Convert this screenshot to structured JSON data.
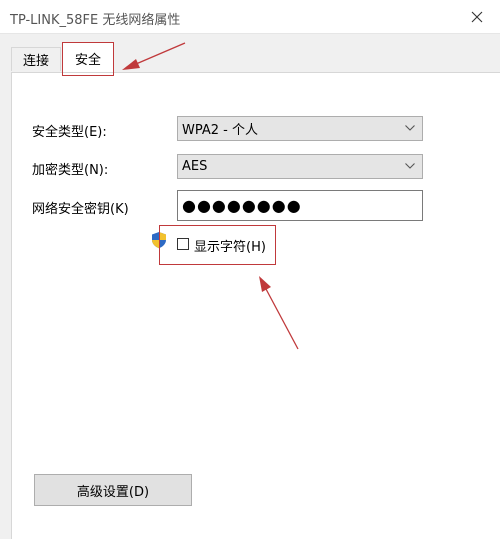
{
  "window": {
    "title": "TP-LINK_58FE 无线网络属性",
    "close_icon": "close-icon"
  },
  "tabs": [
    {
      "label": "连接",
      "selected": false
    },
    {
      "label": "安全",
      "selected": true
    }
  ],
  "form": {
    "security_type_label": "安全类型(E):",
    "security_type_value": "WPA2 - 个人",
    "encryption_type_label": "加密类型(N):",
    "encryption_type_value": "AES",
    "key_label": "网络安全密钥(K)",
    "key_value": "●●●●●●●●",
    "show_chars_label": "显示字符(H)",
    "show_chars_checked": false
  },
  "advanced_button": "高级设置(D)",
  "colors": {
    "annotation": "#c0393b",
    "panel": "#ffffff",
    "background": "#f0f0f0"
  }
}
